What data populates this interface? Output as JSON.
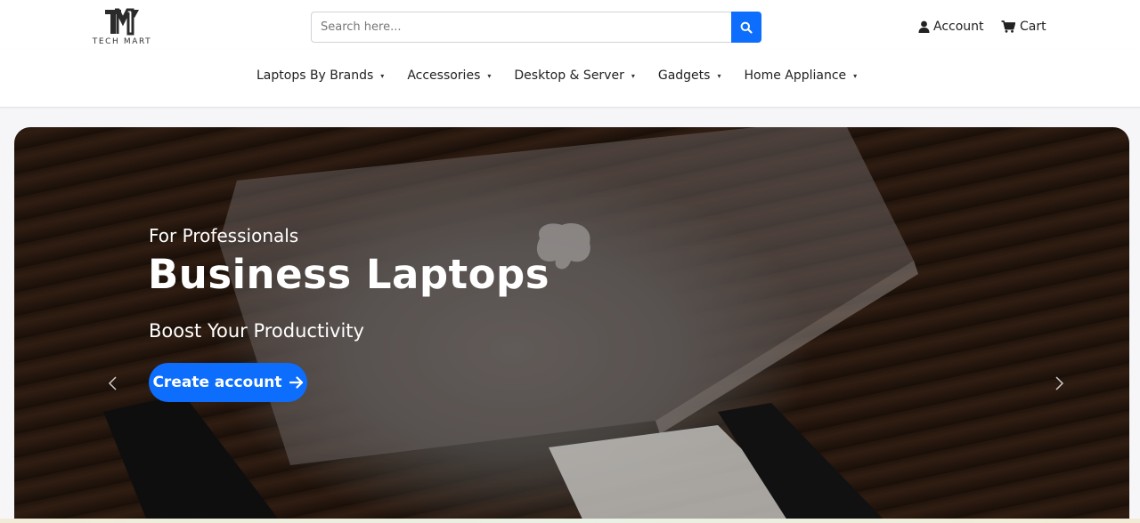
{
  "logo": {
    "brand_text": "TECH MART",
    "icon": "tm-monogram-logo"
  },
  "search": {
    "placeholder": "Search here...",
    "value": "",
    "button_icon": "search-icon",
    "accent": "#0d6efd"
  },
  "header_links": {
    "account": {
      "label": "Account",
      "icon": "user-icon"
    },
    "cart": {
      "label": "Cart",
      "icon": "cart-icon"
    }
  },
  "nav": {
    "items": [
      {
        "label": "Laptops By Brands",
        "caret": "▾"
      },
      {
        "label": "Accessories",
        "caret": "▾"
      },
      {
        "label": "Desktop & Server",
        "caret": "▾"
      },
      {
        "label": "Gadgets",
        "caret": "▾"
      },
      {
        "label": "Home Appliance",
        "caret": "▾"
      }
    ]
  },
  "hero": {
    "eyebrow": "For Professionals",
    "title": "Business Laptops",
    "tagline": "Boost Your Productivity",
    "cta_label": "Create account",
    "cta_icon": "arrow-right-icon",
    "prev_icon": "chevron-left-icon",
    "next_icon": "chevron-right-icon",
    "cta_color": "#0d6efd"
  }
}
